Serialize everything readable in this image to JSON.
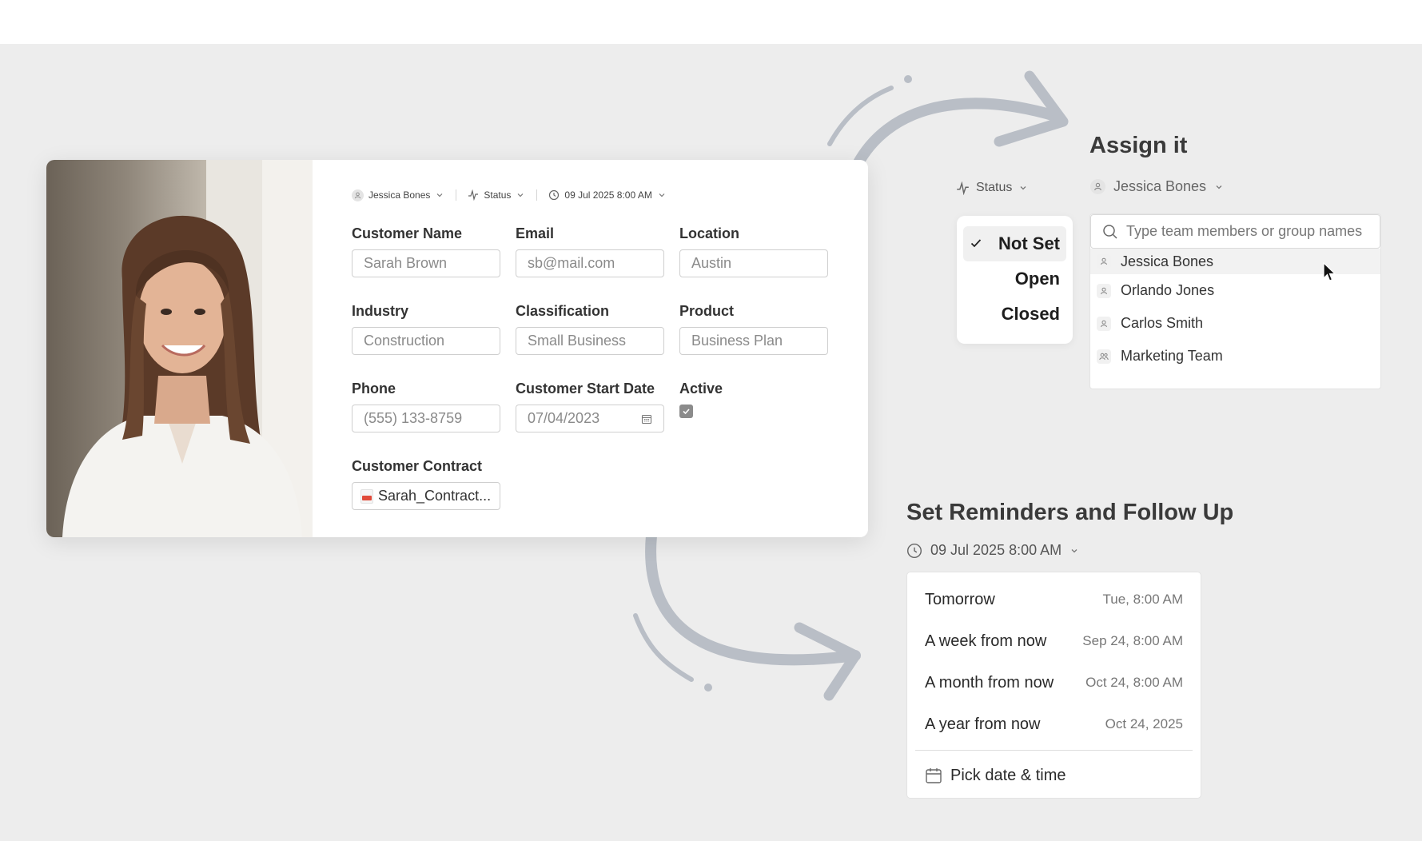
{
  "card": {
    "header": {
      "assignee": "Jessica Bones",
      "status": "Status",
      "datetime": "09 Jul 2025 8:00 AM"
    },
    "fields": {
      "customer_name": {
        "label": "Customer Name",
        "value": "Sarah Brown"
      },
      "email": {
        "label": "Email",
        "value": "sb@mail.com"
      },
      "location": {
        "label": "Location",
        "value": "Austin"
      },
      "industry": {
        "label": "Industry",
        "value": "Construction"
      },
      "classification": {
        "label": "Classification",
        "value": "Small Business"
      },
      "product": {
        "label": "Product",
        "value": "Business Plan"
      },
      "phone": {
        "label": "Phone",
        "value": "(555) 133-8759"
      },
      "start_date": {
        "label": "Customer Start Date",
        "value": "07/04/2023"
      },
      "active": {
        "label": "Active",
        "checked": true
      },
      "contract": {
        "label": "Customer Contract",
        "value": "Sarah_Contract..."
      }
    }
  },
  "status_menu": {
    "trigger": "Status",
    "options": [
      "Not Set",
      "Open",
      "Closed"
    ],
    "selected": "Not Set"
  },
  "assign": {
    "title": "Assign it",
    "trigger": "Jessica Bones",
    "search_placeholder": "Type team members or group names",
    "members": [
      {
        "name": "Jessica Bones",
        "type": "person"
      },
      {
        "name": "Orlando Jones",
        "type": "person"
      },
      {
        "name": "Carlos Smith",
        "type": "person"
      },
      {
        "name": "Marketing Team",
        "type": "group"
      }
    ]
  },
  "reminders": {
    "title": "Set Reminders and Follow Up",
    "trigger": "09 Jul 2025 8:00 AM",
    "options": [
      {
        "label": "Tomorrow",
        "when": "Tue, 8:00 AM"
      },
      {
        "label": "A week from now",
        "when": "Sep 24, 8:00 AM"
      },
      {
        "label": "A month from now",
        "when": "Oct 24, 8:00 AM"
      },
      {
        "label": "A year from now",
        "when": "Oct 24, 2025"
      }
    ],
    "pick": "Pick date & time"
  },
  "colors": {
    "background": "#ededed",
    "arrow": "#b9bec6",
    "checkbox": "#8b8b8b",
    "pdf": "#e04a3a"
  }
}
